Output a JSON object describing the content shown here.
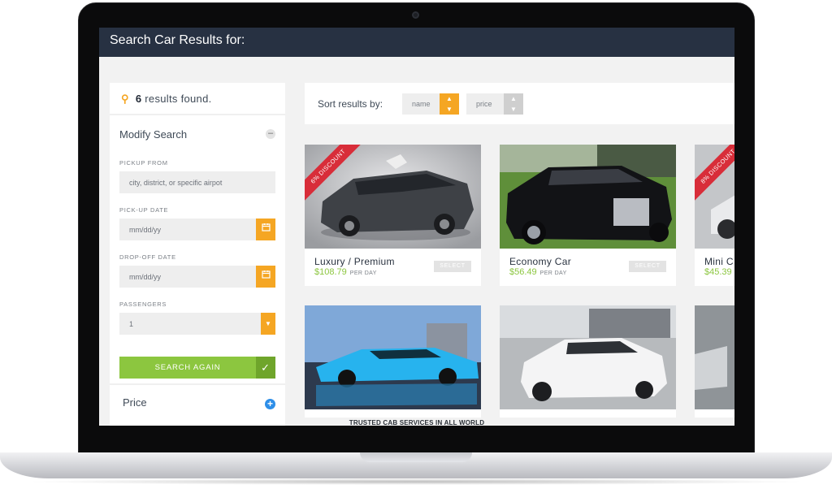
{
  "page_title": "Search Car Results for:",
  "sidebar": {
    "results_count": "6",
    "results_text": "results found.",
    "modify_title": "Modify Search",
    "pickup_from_label": "PICKUP FROM",
    "pickup_from_placeholder": "city, district, or specific airpot",
    "pickup_date_label": "PICK-UP DATE",
    "pickup_date_placeholder": "mm/dd/yy",
    "dropoff_date_label": "DROP-OFF DATE",
    "dropoff_date_placeholder": "mm/dd/yy",
    "passengers_label": "PASSENGERS",
    "passengers_value": "1",
    "search_again_label": "SEARCH AGAIN",
    "price_title": "Price"
  },
  "sort": {
    "label": "Sort results by:",
    "options": [
      "name",
      "price"
    ]
  },
  "cars": [
    {
      "name": "Luxury / Premium",
      "price": "$108.79",
      "per": "PER DAY",
      "select": "SELECT",
      "discount": "6% DISCOUNT"
    },
    {
      "name": "Economy Car",
      "price": "$56.49",
      "per": "PER DAY",
      "select": "SELECT",
      "discount": ""
    },
    {
      "name": "Mini C",
      "price": "$45.39",
      "per": "",
      "select": "",
      "discount": "8% DISCOUNT"
    }
  ],
  "footer_note": "TRUSTED CAB SERVICES IN ALL WORLD",
  "colors": {
    "header_bg": "#273142",
    "accent_orange": "#f5a623",
    "accent_green": "#8cc63f",
    "ribbon_red": "#d82d39",
    "price_plus_blue": "#2d8ee8"
  }
}
